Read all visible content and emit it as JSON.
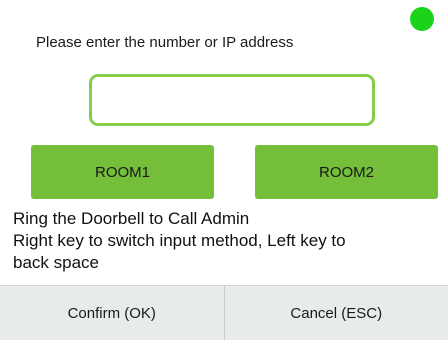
{
  "prompt": "Please enter the number or IP address",
  "input": {
    "value": "",
    "placeholder": ""
  },
  "rooms": [
    {
      "label": "ROOM1"
    },
    {
      "label": "ROOM2"
    }
  ],
  "info_lines": [
    "Ring the Doorbell to Call Admin",
    "Right key to switch input method, Left key to",
    "back space"
  ],
  "footer": {
    "confirm_label": "Confirm (OK)",
    "cancel_label": "Cancel (ESC)"
  },
  "status": {
    "indicator_color": "#1bd31b"
  },
  "colors": {
    "accent_green": "#74be3a",
    "input_border": "#86cd4d",
    "footer_bg": "#e7ece8"
  }
}
